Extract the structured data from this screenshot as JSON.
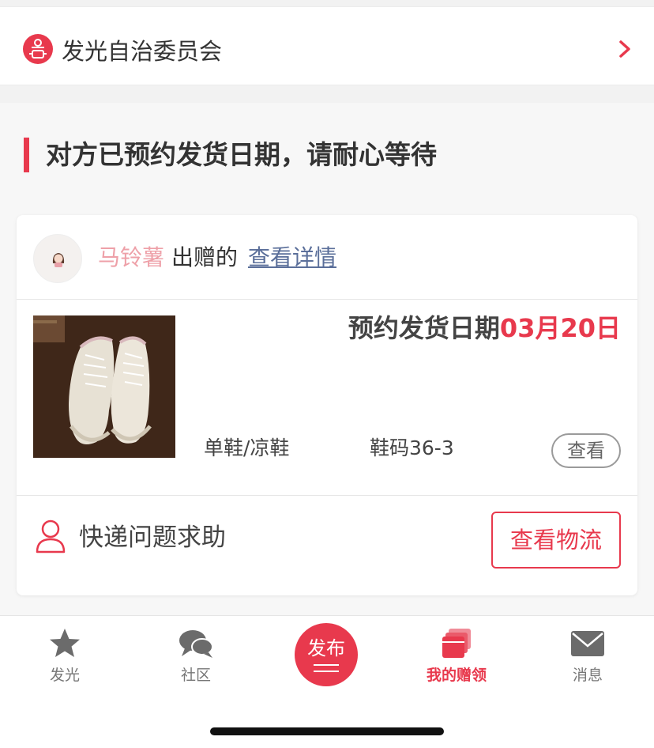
{
  "committee": {
    "name": "发光自治委员会",
    "icon": "committee-icon"
  },
  "status": {
    "title": "对方已预约发货日期，请耐心等待"
  },
  "order": {
    "giver_name": "马铃薯",
    "give_label": "出赠的",
    "detail_link": "查看详情",
    "ship_date_label": "预约发货日期",
    "ship_date_value": "03月20日",
    "category": "单鞋/凉鞋",
    "size": "鞋码36-3",
    "view_button": "查看",
    "help_label": "快递问题求助",
    "logistics_button": "查看物流"
  },
  "tabbar": {
    "tabs": [
      {
        "label": "发光",
        "icon": "star-icon"
      },
      {
        "label": "社区",
        "icon": "chat-bubbles-icon"
      },
      {
        "label": "发布",
        "icon": "publish-icon"
      },
      {
        "label": "我的赠领",
        "icon": "stacked-cards-icon",
        "active": true
      },
      {
        "label": "消息",
        "icon": "envelope-icon"
      }
    ]
  },
  "colors": {
    "accent": "#e8394d",
    "link": "#5b6f9a",
    "giver_name": "#eea0a8"
  }
}
